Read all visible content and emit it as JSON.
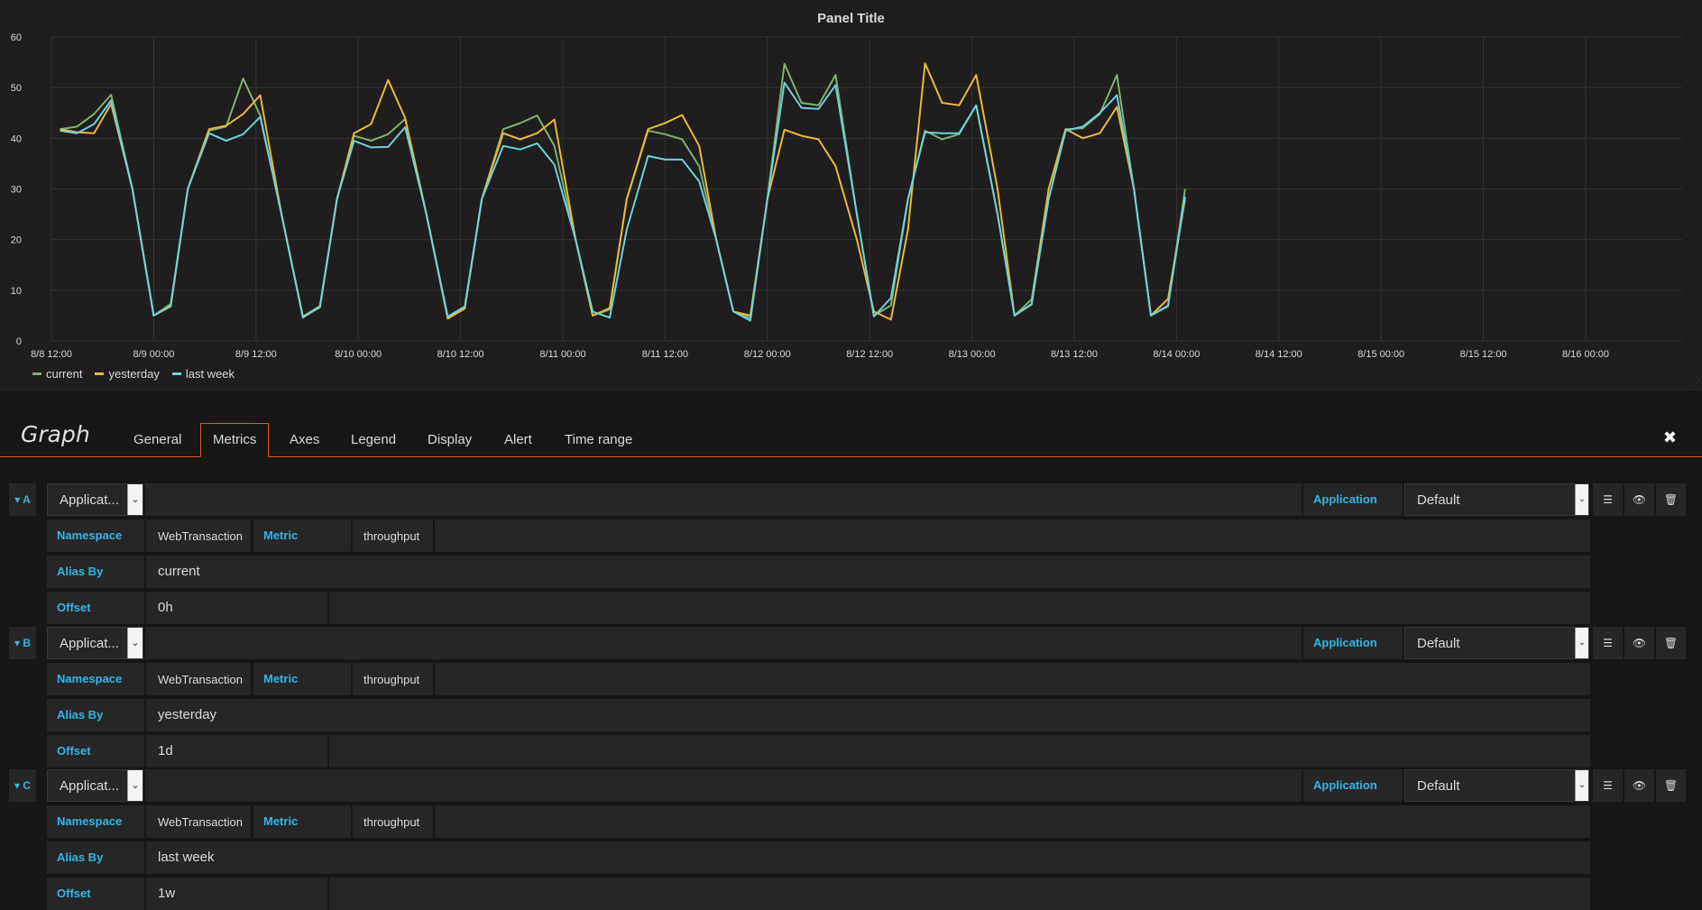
{
  "panel": {
    "title": "Panel Title",
    "legend": [
      {
        "name": "current",
        "color": "#7eb26d"
      },
      {
        "name": "yesterday",
        "color": "#eab839"
      },
      {
        "name": "last week",
        "color": "#6ed0e0"
      }
    ]
  },
  "chart_data": {
    "type": "line",
    "title": "Panel Title",
    "ylim": [
      0,
      60
    ],
    "y_ticks": [
      "0",
      "10",
      "20",
      "30",
      "40",
      "50",
      "60"
    ],
    "x_ticks": [
      "8/8 12:00",
      "8/9 00:00",
      "8/9 12:00",
      "8/10 00:00",
      "8/10 12:00",
      "8/11 00:00",
      "8/11 12:00",
      "8/12 00:00",
      "8/12 12:00",
      "8/13 00:00",
      "8/13 12:00",
      "8/14 00:00",
      "8/14 12:00",
      "8/15 00:00",
      "8/15 12:00",
      "8/16 00:00"
    ],
    "grid": true,
    "legend_position": "bottom-left",
    "x_unit": "hours since 8/8 12:00",
    "series": [
      {
        "name": "current",
        "color": "#7eb26d",
        "points": [
          [
            1,
            41.8
          ],
          [
            3,
            42.3
          ],
          [
            5,
            44.8
          ],
          [
            7,
            48.6
          ],
          [
            9.5,
            30
          ],
          [
            12,
            5
          ],
          [
            14,
            7.3
          ],
          [
            16,
            30
          ],
          [
            18.5,
            41.5
          ],
          [
            20.5,
            42.3
          ],
          [
            22.5,
            51.8
          ],
          [
            24.5,
            44.5
          ],
          [
            27,
            25
          ],
          [
            29.5,
            4.8
          ],
          [
            31.5,
            6.9
          ],
          [
            33.5,
            28
          ],
          [
            35.5,
            40.5
          ],
          [
            37.5,
            39.5
          ],
          [
            39.5,
            40.8
          ],
          [
            41.5,
            43.8
          ],
          [
            44,
            25
          ],
          [
            46.5,
            4.7
          ],
          [
            48.5,
            6.5
          ],
          [
            50.5,
            28
          ],
          [
            53,
            41.8
          ],
          [
            55,
            43
          ],
          [
            57,
            44.5
          ],
          [
            59,
            38.5
          ],
          [
            61.5,
            20
          ],
          [
            63.5,
            5
          ],
          [
            65.5,
            6.2
          ],
          [
            67.5,
            28
          ],
          [
            70,
            41.5
          ],
          [
            72,
            40.8
          ],
          [
            74,
            39.8
          ],
          [
            76,
            34.5
          ],
          [
            78,
            20
          ],
          [
            80,
            5.8
          ],
          [
            82,
            4.5
          ],
          [
            84,
            28
          ],
          [
            86,
            54.7
          ],
          [
            88,
            47
          ],
          [
            90,
            46.5
          ],
          [
            92,
            52.5
          ],
          [
            94.5,
            25
          ],
          [
            96.5,
            5
          ],
          [
            98.5,
            7
          ],
          [
            100.5,
            28
          ],
          [
            102.5,
            41.5
          ],
          [
            104.5,
            39.8
          ],
          [
            106.5,
            40.8
          ],
          [
            108.5,
            46.5
          ],
          [
            111,
            25
          ],
          [
            113,
            5
          ],
          [
            115,
            8.2
          ],
          [
            117,
            30
          ],
          [
            119,
            41.8
          ],
          [
            121,
            42
          ],
          [
            123,
            44.8
          ],
          [
            125,
            52.5
          ],
          [
            127,
            30
          ],
          [
            129,
            5
          ],
          [
            131,
            6.8
          ],
          [
            133,
            30
          ]
        ]
      },
      {
        "name": "yesterday",
        "color": "#eab839",
        "points": [
          [
            1,
            41.8
          ],
          [
            3,
            41.2
          ],
          [
            5,
            41
          ],
          [
            7,
            46.8
          ],
          [
            9.5,
            30
          ],
          [
            12,
            5
          ],
          [
            14,
            6.8
          ],
          [
            16,
            30
          ],
          [
            18.5,
            41.8
          ],
          [
            20.5,
            42.5
          ],
          [
            22.5,
            44.8
          ],
          [
            24.5,
            48.5
          ],
          [
            27,
            25
          ],
          [
            29.5,
            4.8
          ],
          [
            31.5,
            6.6
          ],
          [
            33.5,
            28
          ],
          [
            35.5,
            41
          ],
          [
            37.5,
            42.8
          ],
          [
            39.5,
            51.5
          ],
          [
            41.5,
            44
          ],
          [
            44,
            25
          ],
          [
            46.5,
            4.4
          ],
          [
            48.5,
            6.4
          ],
          [
            50.5,
            28
          ],
          [
            53,
            41
          ],
          [
            55,
            39.8
          ],
          [
            57,
            41
          ],
          [
            59,
            43.7
          ],
          [
            61.5,
            20
          ],
          [
            63.5,
            5
          ],
          [
            65.5,
            6.5
          ],
          [
            67.5,
            28
          ],
          [
            70,
            41.8
          ],
          [
            72,
            43
          ],
          [
            74,
            44.6
          ],
          [
            76,
            38.5
          ],
          [
            78,
            20
          ],
          [
            80,
            5.8
          ],
          [
            82,
            5
          ],
          [
            84,
            28
          ],
          [
            86,
            41.7
          ],
          [
            88,
            40.5
          ],
          [
            90,
            39.8
          ],
          [
            92,
            34.5
          ],
          [
            94.5,
            20
          ],
          [
            96.5,
            5.8
          ],
          [
            98.5,
            4.2
          ],
          [
            100.5,
            22
          ],
          [
            102.5,
            54.8
          ],
          [
            104.5,
            47
          ],
          [
            106.5,
            46.5
          ],
          [
            108.5,
            52.5
          ],
          [
            111,
            30
          ],
          [
            113,
            5
          ],
          [
            115,
            7.2
          ],
          [
            117,
            30
          ],
          [
            119,
            41.8
          ],
          [
            121,
            40
          ],
          [
            123,
            41
          ],
          [
            125,
            46.2
          ],
          [
            127,
            30
          ],
          [
            129,
            5
          ],
          [
            131,
            8.3
          ],
          [
            133,
            28
          ]
        ]
      },
      {
        "name": "last week",
        "color": "#6ed0e0",
        "points": [
          [
            1,
            41.5
          ],
          [
            3,
            41
          ],
          [
            5,
            42.8
          ],
          [
            7,
            47.5
          ],
          [
            9.5,
            30
          ],
          [
            12,
            5
          ],
          [
            14,
            7
          ],
          [
            16,
            30
          ],
          [
            18.5,
            41
          ],
          [
            20.5,
            39.5
          ],
          [
            22.5,
            40.8
          ],
          [
            24.5,
            44.2
          ],
          [
            27,
            25
          ],
          [
            29.5,
            4.6
          ],
          [
            31.5,
            6.7
          ],
          [
            33.5,
            28
          ],
          [
            35.5,
            39.5
          ],
          [
            37.5,
            38.2
          ],
          [
            39.5,
            38.3
          ],
          [
            41.5,
            42.2
          ],
          [
            44,
            25
          ],
          [
            46.5,
            4.8
          ],
          [
            48.5,
            6.8
          ],
          [
            50.5,
            28
          ],
          [
            53,
            38.5
          ],
          [
            55,
            37.8
          ],
          [
            57,
            39
          ],
          [
            59,
            34.8
          ],
          [
            61.5,
            20
          ],
          [
            63.5,
            5.8
          ],
          [
            65.5,
            4.6
          ],
          [
            67.5,
            22
          ],
          [
            70,
            36.5
          ],
          [
            72,
            35.8
          ],
          [
            74,
            35.8
          ],
          [
            76,
            31.5
          ],
          [
            78,
            20
          ],
          [
            80,
            5.8
          ],
          [
            82,
            4
          ],
          [
            84,
            28
          ],
          [
            86,
            51
          ],
          [
            88,
            46
          ],
          [
            90,
            45.8
          ],
          [
            92,
            50.5
          ],
          [
            94.5,
            25
          ],
          [
            96.5,
            4.8
          ],
          [
            98.5,
            8.5
          ],
          [
            100.5,
            28
          ],
          [
            102.5,
            41.2
          ],
          [
            104.5,
            41
          ],
          [
            106.5,
            41
          ],
          [
            108.5,
            46.5
          ],
          [
            111,
            25
          ],
          [
            113,
            5
          ],
          [
            115,
            7.3
          ],
          [
            117,
            28
          ],
          [
            119,
            41.5
          ],
          [
            121,
            42.3
          ],
          [
            123,
            45
          ],
          [
            125,
            48.5
          ],
          [
            127,
            30
          ],
          [
            129,
            5
          ],
          [
            131,
            7
          ],
          [
            133,
            28.5
          ]
        ]
      }
    ]
  },
  "editor": {
    "title": "Graph",
    "close_icon": "✖",
    "tabs": [
      "General",
      "Metrics",
      "Axes",
      "Legend",
      "Display",
      "Alert",
      "Time range"
    ],
    "active_tab": "Metrics"
  },
  "queries": [
    {
      "ref": "A",
      "source_select": "Applicat...",
      "application_label": "Application",
      "application_value": "Default",
      "namespace_label": "Namespace",
      "namespace_value": "WebTransaction",
      "metric_label": "Metric",
      "metric_value": "throughput",
      "alias_label": "Alias By",
      "alias_value": "current",
      "offset_label": "Offset",
      "offset_value": "0h"
    },
    {
      "ref": "B",
      "source_select": "Applicat...",
      "application_label": "Application",
      "application_value": "Default",
      "namespace_label": "Namespace",
      "namespace_value": "WebTransaction",
      "metric_label": "Metric",
      "metric_value": "throughput",
      "alias_label": "Alias By",
      "alias_value": "yesterday",
      "offset_label": "Offset",
      "offset_value": "1d"
    },
    {
      "ref": "C",
      "source_select": "Applicat...",
      "application_label": "Application",
      "application_value": "Default",
      "namespace_label": "Namespace",
      "namespace_value": "WebTransaction",
      "metric_label": "Metric",
      "metric_value": "throughput",
      "alias_label": "Alias By",
      "alias_value": "last week",
      "offset_label": "Offset",
      "offset_value": "1w"
    }
  ],
  "icons": {
    "collapse": "chevron-down-icon",
    "menu": "hamburger-icon",
    "toggle": "eye-icon",
    "remove": "trash-icon"
  }
}
